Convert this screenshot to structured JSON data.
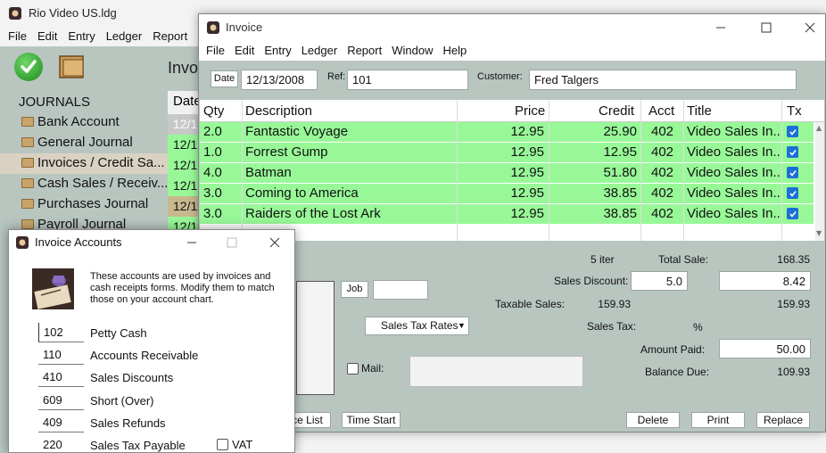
{
  "main": {
    "title": "Rio Video US.ldg",
    "menu": [
      "File",
      "Edit",
      "Entry",
      "Ledger",
      "Report"
    ],
    "heading": "Invo",
    "journals_header": "JOURNALS",
    "journals": [
      {
        "label": "Bank Account"
      },
      {
        "label": "General Journal"
      },
      {
        "label": "Invoices / Credit Sa..."
      },
      {
        "label": "Cash Sales / Receiv..."
      },
      {
        "label": "Purchases Journal"
      },
      {
        "label": "Payroll Journal"
      }
    ],
    "date_header": "Date",
    "date_cells": [
      "12/1",
      "12/1",
      "12/1",
      "12/1",
      "12/1",
      "12/1"
    ],
    "colors": {
      "date_cell_first": "#c8c8c8",
      "date_cell_green": "#98f898",
      "date_cell_tan": "#c8b88e"
    }
  },
  "invoice": {
    "title": "Invoice",
    "menu": [
      "File",
      "Edit",
      "Entry",
      "Ledger",
      "Report",
      "Window",
      "Help"
    ],
    "date_button": "Date",
    "date_value": "12/13/2008",
    "ref_label": "Ref:",
    "ref_value": "101",
    "customer_label": "Customer:",
    "customer_value": "Fred Talgers",
    "columns": [
      "Qty",
      "Description",
      "Price",
      "Credit",
      "Acct",
      "Title",
      "Tx"
    ],
    "rows": [
      {
        "qty": "2.0",
        "description": "Fantastic Voyage",
        "price": "12.95",
        "credit": "25.90",
        "acct": "402",
        "title": "Video Sales In...",
        "tx": true
      },
      {
        "qty": "1.0",
        "description": "Forrest Gump",
        "price": "12.95",
        "credit": "12.95",
        "acct": "402",
        "title": "Video Sales In...",
        "tx": true
      },
      {
        "qty": "4.0",
        "description": "Batman",
        "price": "12.95",
        "credit": "51.80",
        "acct": "402",
        "title": "Video Sales In...",
        "tx": true
      },
      {
        "qty": "3.0",
        "description": "Coming to America",
        "price": "12.95",
        "credit": "38.85",
        "acct": "402",
        "title": "Video Sales In...",
        "tx": true
      },
      {
        "qty": "3.0",
        "description": "Raiders of the Lost Ark",
        "price": "12.95",
        "credit": "38.85",
        "acct": "402",
        "title": "Video Sales In...",
        "tx": true
      }
    ],
    "item_count": "5 iter",
    "total_sale_label": "Total Sale:",
    "total_sale_value": "168.35",
    "job_button": "Job",
    "job_value": "",
    "sales_discount_label": "Sales Discount:",
    "sales_discount_pct": "5.0",
    "sales_discount_value": "8.42",
    "taxable_sales_label": "Taxable Sales:",
    "taxable_sales_value": "159.93",
    "subtotal_value": "159.93",
    "sales_tax_rates_button": "Sales Tax Rates",
    "sales_tax_label": "Sales Tax:",
    "sales_tax_pct": "%",
    "amount_paid_label": "Amount Paid:",
    "amount_paid_value": "50.00",
    "balance_due_label": "Balance Due:",
    "balance_due_value": "109.93",
    "mail_label": "Mail:",
    "price_list_button": "ce List",
    "time_start_button": "Time Start",
    "delete_button": "Delete",
    "print_button": "Print",
    "replace_button": "Replace",
    "colors": {
      "row_green": "#98f898",
      "window_bg": "#b9c6c0",
      "checkbox_blue": "#1a6fd8"
    }
  },
  "accounts_dialog": {
    "title": "Invoice Accounts",
    "description": "These accounts are used by invoices and cash receipts forms.  Modify them to match those on your account chart.",
    "accounts": [
      {
        "number": "102",
        "label": "Petty Cash"
      },
      {
        "number": "110",
        "label": "Accounts Receivable"
      },
      {
        "number": "410",
        "label": "Sales Discounts"
      },
      {
        "number": "609",
        "label": "Short (Over)"
      },
      {
        "number": "409",
        "label": "Sales Refunds"
      },
      {
        "number": "220",
        "label": "Sales Tax Payable"
      }
    ],
    "vat_label": "VAT"
  }
}
